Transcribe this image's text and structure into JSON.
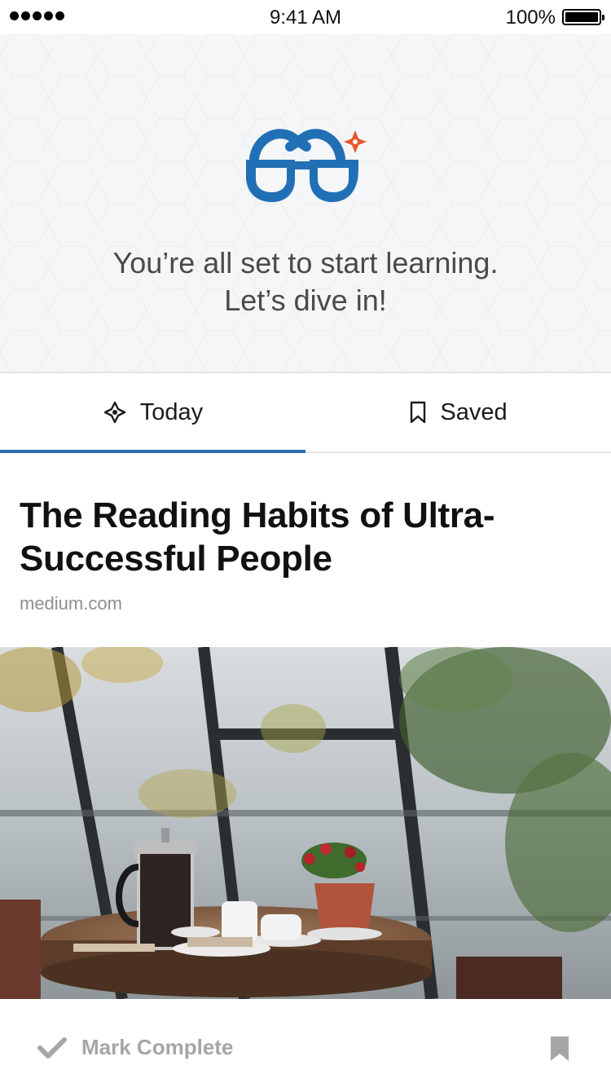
{
  "status_bar": {
    "time": "9:41 AM",
    "battery": "100%"
  },
  "hero": {
    "line1": "You’re all set to start learning.",
    "line2": "Let’s dive in!",
    "logo_icon": "glasses-logo-icon"
  },
  "tabs": [
    {
      "label": "Today",
      "icon": "compass-icon",
      "active": true
    },
    {
      "label": "Saved",
      "icon": "bookmark-outline-icon",
      "active": false
    }
  ],
  "article": {
    "title": "The Reading Habits of Ultra-Successful People",
    "source": "medium.com",
    "image": "cafe-table-photo"
  },
  "bottom_bar": {
    "mark_complete_label": "Mark Complete",
    "bookmark_icon": "bookmark-icon"
  },
  "colors": {
    "accent": "#2b6fb0",
    "logo_blue": "#2170b6",
    "logo_orange": "#e8562a",
    "muted": "#a6a6a6"
  }
}
